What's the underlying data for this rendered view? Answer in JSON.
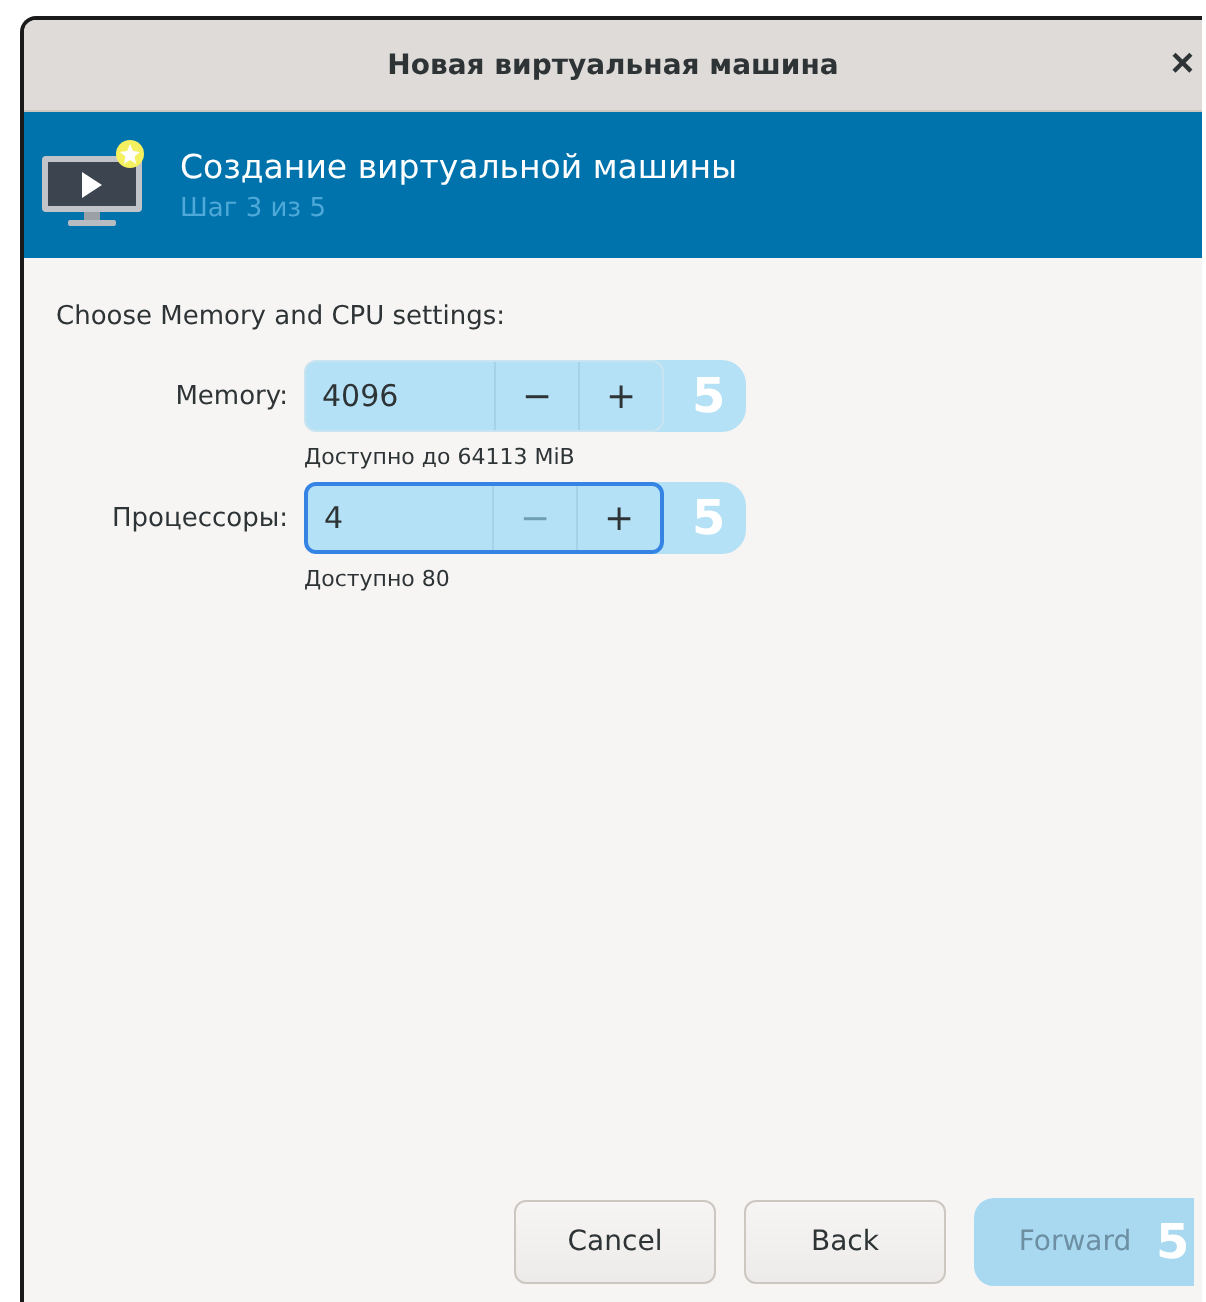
{
  "window": {
    "title": "Новая виртуальная машина",
    "close": "×"
  },
  "header": {
    "title": "Создание виртуальной машины",
    "subtitle": "Шаг 3 из 5"
  },
  "prompt": "Choose Memory and CPU settings:",
  "spinners": [
    {
      "label": "Memory:",
      "value": "4096",
      "minus": "−",
      "plus": "+",
      "minus_disabled": false,
      "focused": false,
      "hint": "Доступно до 64113 MiB",
      "badge": "5"
    },
    {
      "label": "Процессоры:",
      "value": "4",
      "minus": "−",
      "plus": "+",
      "minus_disabled": true,
      "focused": true,
      "hint": "Доступно 80",
      "badge": "5"
    }
  ],
  "buttons": [
    {
      "label": "Cancel",
      "kind": "normal"
    },
    {
      "label": "Back",
      "kind": "normal"
    },
    {
      "label": "Forward",
      "kind": "highlighted",
      "badge": "5"
    }
  ]
}
